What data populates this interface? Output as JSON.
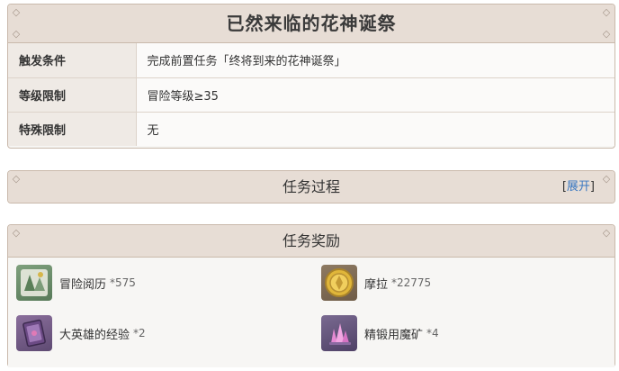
{
  "quest": {
    "title": "已然来临的花神诞祭",
    "info": [
      {
        "key": "触发条件",
        "value": "完成前置任务「终将到来的花神诞祭」"
      },
      {
        "key": "等级限制",
        "value": "冒险等级≥35"
      },
      {
        "key": "特殊限制",
        "value": "无"
      }
    ]
  },
  "process": {
    "title": "任务过程",
    "expand_bracket_open": "[",
    "expand_label": "展开",
    "expand_bracket_close": "]"
  },
  "rewards": {
    "title": "任务奖励",
    "items": [
      {
        "name": "冒险阅历",
        "count": "*575",
        "icon": "adventure-exp-icon"
      },
      {
        "name": "摩拉",
        "count": "*22775",
        "icon": "mora-icon"
      },
      {
        "name": "大英雄的经验",
        "count": "*2",
        "icon": "heros-wit-icon"
      },
      {
        "name": "精锻用魔矿",
        "count": "*4",
        "icon": "mystic-enhancement-ore-icon"
      }
    ]
  },
  "colors": {
    "header_bg": "#e7ddd5",
    "border": "#c9b9ab",
    "link": "#3a78c2"
  }
}
